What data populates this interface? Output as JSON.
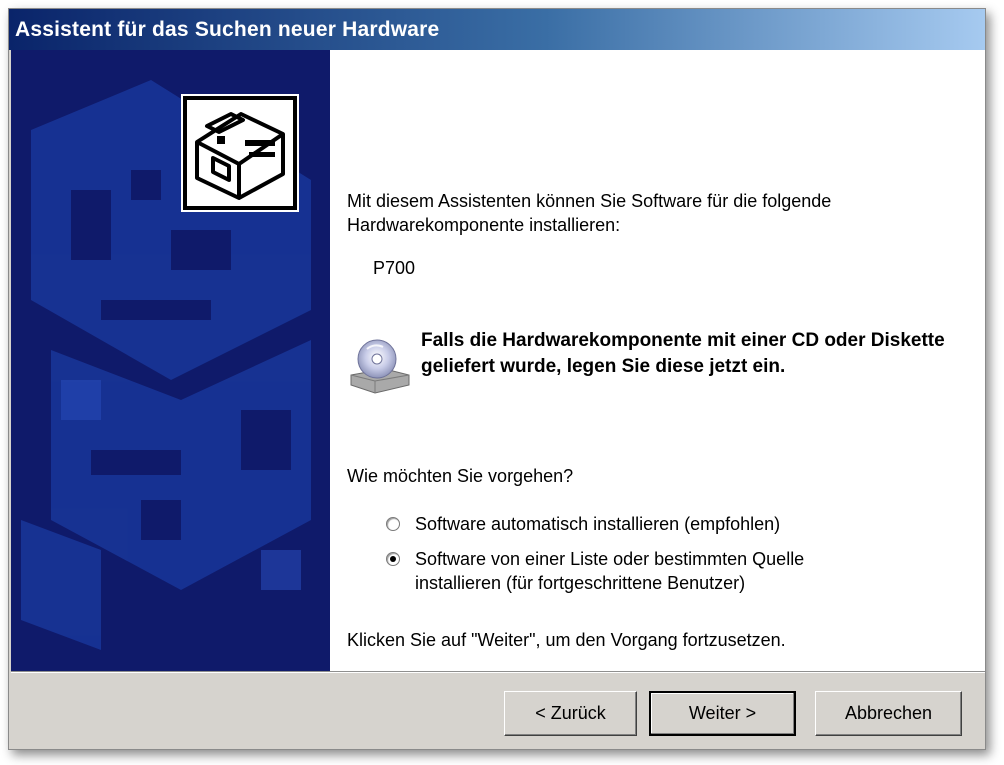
{
  "window": {
    "title": "Assistent für das Suchen neuer Hardware"
  },
  "content": {
    "intro": "Mit diesem Assistenten können Sie Software für die folgende Hardwarekomponente installieren:",
    "device_name": "P700",
    "cd_notice": "Falls die Hardwarekomponente mit einer CD oder Diskette geliefert wurde, legen Sie diese jetzt ein.",
    "question": "Wie möchten Sie vorgehen?",
    "options": [
      {
        "label": "Software automatisch installieren (empfohlen)",
        "selected": false
      },
      {
        "label": "Software von einer Liste oder bestimmten Quelle installieren (für fortgeschrittene Benutzer)",
        "selected": true
      }
    ],
    "footer_hint": "Klicken Sie auf \"Weiter\", um den Vorgang fortzusetzen."
  },
  "buttons": {
    "back": "< Zurück",
    "next": "Weiter >",
    "cancel": "Abbrechen"
  },
  "icons": {
    "hardware": "hardware-card-icon",
    "cd": "cd-drive-icon"
  },
  "colors": {
    "sidebar": "#0f1a6a",
    "title_start": "#0a246a",
    "title_end": "#a6caf0"
  }
}
